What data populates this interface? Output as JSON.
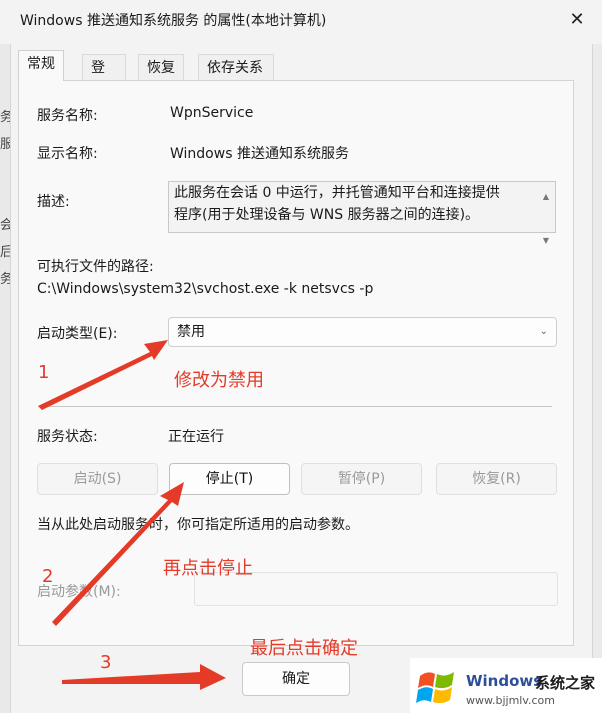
{
  "window": {
    "title": "Windows 推送通知系统服务 的属性(本地计算机)",
    "close_glyph": "✕"
  },
  "background_chars": [
    "务",
    "服",
    "",
    "",
    "会",
    "后",
    "务"
  ],
  "tabs": [
    {
      "label": "常规",
      "active": true
    },
    {
      "label": "登录",
      "active": false
    },
    {
      "label": "恢复",
      "active": false
    },
    {
      "label": "依存关系",
      "active": false
    }
  ],
  "general": {
    "service_name_label": "服务名称:",
    "service_name_value": "WpnService",
    "display_name_label": "显示名称:",
    "display_name_value": "Windows 推送通知系统服务",
    "description_label": "描述:",
    "description_line1": "此服务在会话 0 中运行，并托管通知平台和连接提供",
    "description_line2": "程序(用于处理设备与 WNS 服务器之间的连接)。",
    "path_label": "可执行文件的路径:",
    "path_value": "C:\\Windows\\system32\\svchost.exe -k netsvcs -p",
    "startup_type_label": "启动类型(E):",
    "startup_type_value": "禁用",
    "status_label": "服务状态:",
    "status_value": "正在运行",
    "start_button": "启动(S)",
    "stop_button": "停止(T)",
    "pause_button": "暂停(P)",
    "resume_button": "恢复(R)",
    "hint_text": "当从此处启动服务时，你可指定所适用的启动参数。",
    "param_label": "启动参数(M):",
    "ok_button": "确定"
  },
  "annotations": {
    "step1_number": "1",
    "step1_text": "修改为禁用",
    "step2_number": "2",
    "step2_text": "再点击停止",
    "step3_number": "3",
    "step3_text": "最后点击确定",
    "color": "#e33b28"
  },
  "watermark": {
    "brand_part1": "Windows",
    "brand_part2": "系统之家",
    "url": "www.bjjmlv.com"
  },
  "colors": {
    "window_bg": "#f3f3f3",
    "panel_bg": "#f9f9f9",
    "annotation_red": "#e33b28",
    "windows_logo": [
      "#f25022",
      "#7fba00",
      "#00a4ef",
      "#ffb900"
    ]
  }
}
